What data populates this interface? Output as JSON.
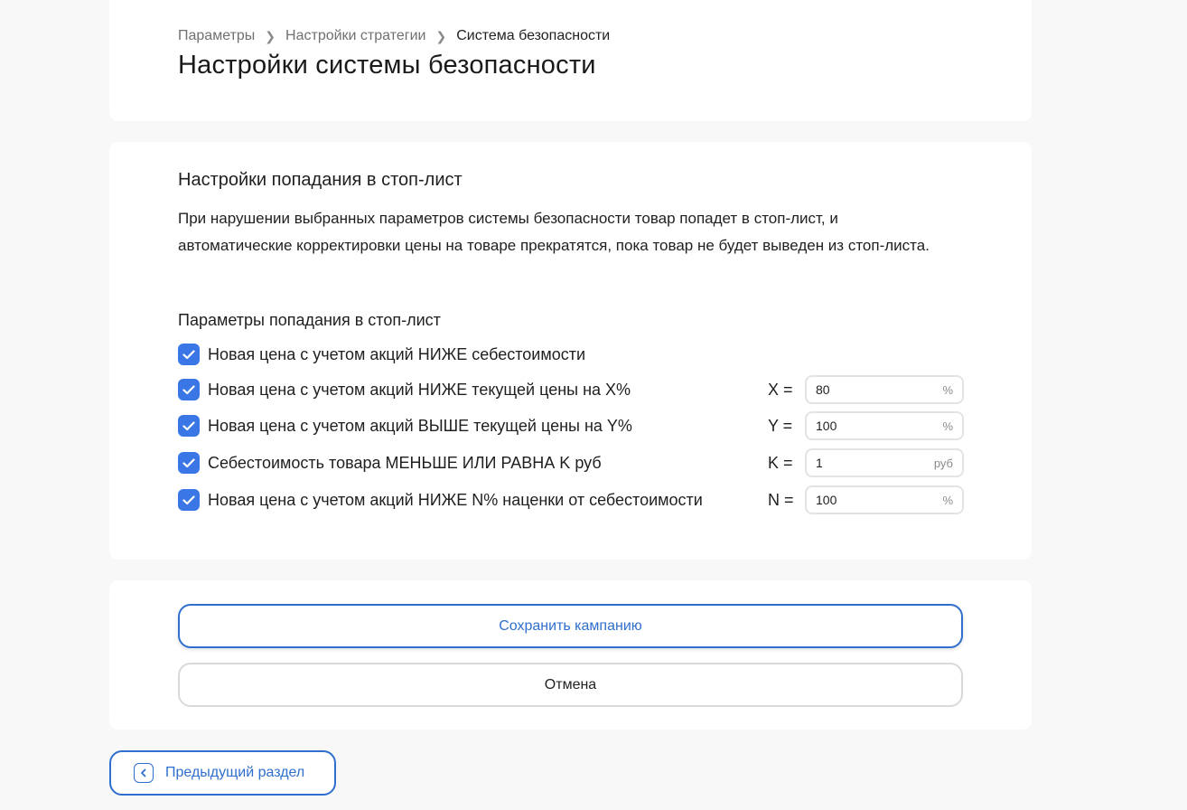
{
  "breadcrumb": {
    "items": [
      "Параметры",
      "Настройки стратегии",
      "Система безопасности"
    ]
  },
  "page_title": "Настройки системы безопасности",
  "stoplist": {
    "title": "Настройки попадания в стоп-лист",
    "description": "При нарушении выбранных параметров системы безопасности товар попадет в стоп-лист, и автоматические корректировки цены на товаре прекратятся, пока товар не будет выведен из стоп-листа.",
    "params_title": "Параметры попадания в стоп-лист",
    "params": [
      {
        "label": "Новая цена с учетом акций НИЖЕ себестоимости",
        "checked": true
      },
      {
        "label": "Новая цена с учетом акций НИЖЕ текущей цены на X%",
        "checked": true,
        "var": "X =",
        "value": "80",
        "unit": "%"
      },
      {
        "label": "Новая цена с учетом акций ВЫШЕ текущей цены на Y%",
        "checked": true,
        "var": "Y =",
        "value": "100",
        "unit": "%"
      },
      {
        "label": "Себестоимость товара МЕНЬШЕ ИЛИ РАВНА K руб",
        "checked": true,
        "var": "K =",
        "value": "1",
        "unit": "руб"
      },
      {
        "label": "Новая цена с учетом акций НИЖЕ N% наценки от себестоимости",
        "checked": true,
        "var": "N =",
        "value": "100",
        "unit": "%"
      }
    ]
  },
  "actions": {
    "save_label": "Сохранить кампанию",
    "cancel_label": "Отмена"
  },
  "nav": {
    "prev_label": "Предыдущий раздел",
    "prev_icon": "chevron-left-icon"
  },
  "colors": {
    "accent": "#2f6fce",
    "checkbox": "#3b76e6",
    "background": "#f8f8f9"
  }
}
